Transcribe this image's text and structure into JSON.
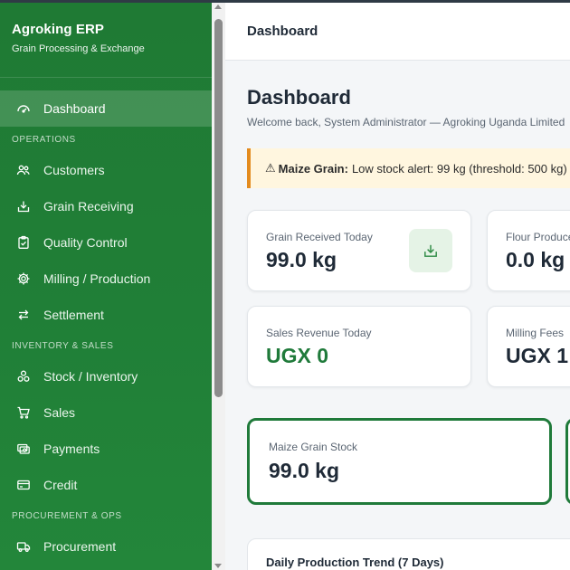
{
  "app": {
    "name": "Agroking ERP",
    "tagline": "Grain Processing & Exchange"
  },
  "sidebar": {
    "items": [
      {
        "label": "Dashboard",
        "icon": "gauge-icon",
        "active": true
      },
      {
        "section": "OPERATIONS"
      },
      {
        "label": "Customers",
        "icon": "users-icon"
      },
      {
        "label": "Grain Receiving",
        "icon": "receive-icon"
      },
      {
        "label": "Quality Control",
        "icon": "clipboard-check-icon"
      },
      {
        "label": "Milling / Production",
        "icon": "gear-icon"
      },
      {
        "label": "Settlement",
        "icon": "arrows-exchange-icon"
      },
      {
        "section": "INVENTORY & SALES"
      },
      {
        "label": "Stock / Inventory",
        "icon": "boxes-icon"
      },
      {
        "label": "Sales",
        "icon": "cart-icon"
      },
      {
        "label": "Payments",
        "icon": "cash-icon"
      },
      {
        "label": "Credit",
        "icon": "credit-card-icon"
      },
      {
        "section": "PROCUREMENT & OPS"
      },
      {
        "label": "Procurement",
        "icon": "truck-icon"
      }
    ]
  },
  "header": {
    "title": "Dashboard"
  },
  "page": {
    "title": "Dashboard",
    "subtitle": "Welcome back, System Administrator — Agroking Uganda Limited"
  },
  "alert": {
    "icon": "warning-icon",
    "title": "Maize Grain:",
    "message": "Low stock alert: 99 kg (threshold: 500 kg)"
  },
  "stats": [
    {
      "label": "Grain Received Today",
      "value": "99.0 kg",
      "icon": "download-icon"
    },
    {
      "label": "Flour Produced Today",
      "value": "0.0 kg"
    },
    {
      "label": "Sales Revenue Today",
      "value": "UGX 0",
      "accent": true
    },
    {
      "label": "Milling Fees",
      "value": "UGX 1"
    }
  ],
  "stock": {
    "label": "Maize Grain Stock",
    "value": "99.0 kg"
  },
  "trend": {
    "title": "Daily Production Trend (7 Days)"
  },
  "colors": {
    "sidebar": "#1f7a34",
    "accent_green": "#1f7a3a",
    "alert_border": "#e38b1e",
    "alert_bg": "#fff6df"
  }
}
